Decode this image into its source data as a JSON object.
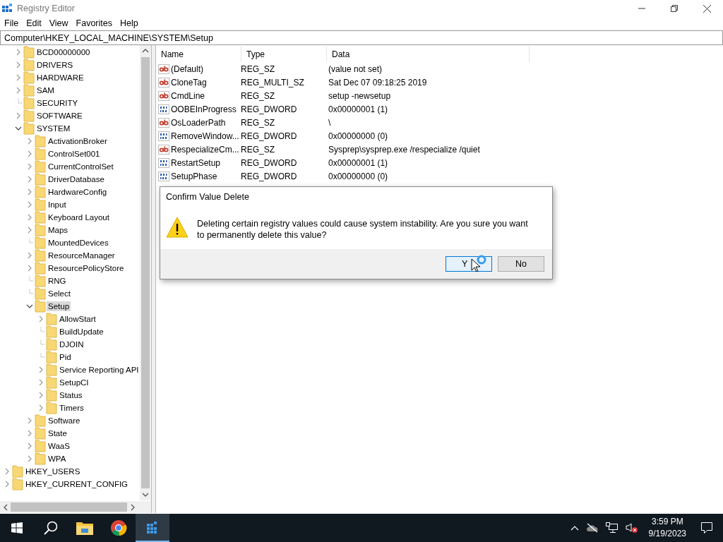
{
  "window": {
    "title": "Registry Editor"
  },
  "menu": [
    "File",
    "Edit",
    "View",
    "Favorites",
    "Help"
  ],
  "address": "Computer\\HKEY_LOCAL_MACHINE\\SYSTEM\\Setup",
  "tree": [
    {
      "children": [
        {
          "label": "BCD00000000",
          "kind": "collapsed",
          "selected": false
        },
        {
          "label": "DRIVERS",
          "kind": "collapsed",
          "selected": false
        },
        {
          "label": "HARDWARE",
          "kind": "collapsed",
          "selected": false
        },
        {
          "label": "SAM",
          "kind": "collapsed",
          "selected": false
        },
        {
          "label": "SECURITY",
          "kind": "leaf",
          "selected": false
        },
        {
          "label": "SOFTWARE",
          "kind": "collapsed",
          "selected": false
        },
        {
          "label": "SYSTEM",
          "kind": "expanded",
          "selected": false,
          "children": [
            {
              "label": "ActivationBroker",
              "kind": "collapsed",
              "selected": false
            },
            {
              "label": "ControlSet001",
              "kind": "collapsed",
              "selected": false
            },
            {
              "label": "CurrentControlSet",
              "kind": "collapsed",
              "selected": false
            },
            {
              "label": "DriverDatabase",
              "kind": "collapsed",
              "selected": false
            },
            {
              "label": "HardwareConfig",
              "kind": "collapsed",
              "selected": false
            },
            {
              "label": "Input",
              "kind": "collapsed",
              "selected": false
            },
            {
              "label": "Keyboard Layout",
              "kind": "collapsed",
              "selected": false
            },
            {
              "label": "Maps",
              "kind": "collapsed",
              "selected": false
            },
            {
              "label": "MountedDevices",
              "kind": "leaf",
              "selected": false
            },
            {
              "label": "ResourceManager",
              "kind": "collapsed",
              "selected": false
            },
            {
              "label": "ResourcePolicyStore",
              "kind": "collapsed",
              "selected": false
            },
            {
              "label": "RNG",
              "kind": "leaf",
              "selected": false
            },
            {
              "label": "Select",
              "kind": "leaf",
              "selected": false
            },
            {
              "label": "Setup",
              "kind": "expanded",
              "selected": true,
              "children": [
                {
                  "label": "AllowStart",
                  "kind": "collapsed",
                  "selected": false
                },
                {
                  "label": "BuildUpdate",
                  "kind": "leaf",
                  "selected": false
                },
                {
                  "label": "DJOIN",
                  "kind": "leaf",
                  "selected": false
                },
                {
                  "label": "Pid",
                  "kind": "leaf",
                  "selected": false
                },
                {
                  "label": "Service Reporting API",
                  "kind": "collapsed",
                  "selected": false
                },
                {
                  "label": "SetupCI",
                  "kind": "collapsed",
                  "selected": false
                },
                {
                  "label": "Status",
                  "kind": "collapsed",
                  "selected": false
                },
                {
                  "label": "Timers",
                  "kind": "collapsed",
                  "selected": false
                }
              ]
            },
            {
              "label": "Software",
              "kind": "collapsed",
              "selected": false
            },
            {
              "label": "State",
              "kind": "collapsed",
              "selected": false
            },
            {
              "label": "WaaS",
              "kind": "collapsed",
              "selected": false
            },
            {
              "label": "WPA",
              "kind": "collapsed",
              "selected": false
            }
          ]
        }
      ]
    },
    {
      "label": "HKEY_USERS",
      "kind": "collapsed",
      "selected": false
    },
    {
      "label": "HKEY_CURRENT_CONFIG",
      "kind": "collapsed",
      "selected": false
    }
  ],
  "values": {
    "columns": [
      "Name",
      "Type",
      "Data"
    ],
    "rows": [
      {
        "kind": "string",
        "name": "(Default)",
        "type": "REG_SZ",
        "data": "(value not set)"
      },
      {
        "kind": "string",
        "name": "CloneTag",
        "type": "REG_MULTI_SZ",
        "data": "Sat Dec 07 09:18:25 2019"
      },
      {
        "kind": "string",
        "name": "CmdLine",
        "type": "REG_SZ",
        "data": "setup -newsetup"
      },
      {
        "kind": "binary",
        "name": "OOBEInProgress",
        "type": "REG_DWORD",
        "data": "0x00000001 (1)"
      },
      {
        "kind": "string",
        "name": "OsLoaderPath",
        "type": "REG_SZ",
        "data": "\\"
      },
      {
        "kind": "binary",
        "name": "RemoveWindow...",
        "type": "REG_DWORD",
        "data": "0x00000000 (0)"
      },
      {
        "kind": "string",
        "name": "RespecializeCm...",
        "type": "REG_SZ",
        "data": "Sysprep\\sysprep.exe /respecialize /quiet"
      },
      {
        "kind": "binary",
        "name": "RestartSetup",
        "type": "REG_DWORD",
        "data": "0x00000001 (1)"
      },
      {
        "kind": "binary",
        "name": "SetupPhase",
        "type": "REG_DWORD",
        "data": "0x00000000 (0)"
      }
    ]
  },
  "dialog": {
    "title": "Confirm Value Delete",
    "message": "Deleting certain registry values could cause system instability. Are you sure you want to permanently delete this value?",
    "buttons": [
      {
        "label": "Y",
        "default": true
      },
      {
        "label": "No",
        "default": false
      }
    ]
  },
  "taskbar": {
    "apps": [
      {
        "kind": "start",
        "selected": false
      },
      {
        "kind": "search",
        "selected": false
      },
      {
        "kind": "explorer",
        "selected": false
      },
      {
        "kind": "browser",
        "selected": false
      },
      {
        "kind": "regedit",
        "selected": true
      }
    ],
    "time": "3:59 PM",
    "date": "9/19/2023"
  }
}
